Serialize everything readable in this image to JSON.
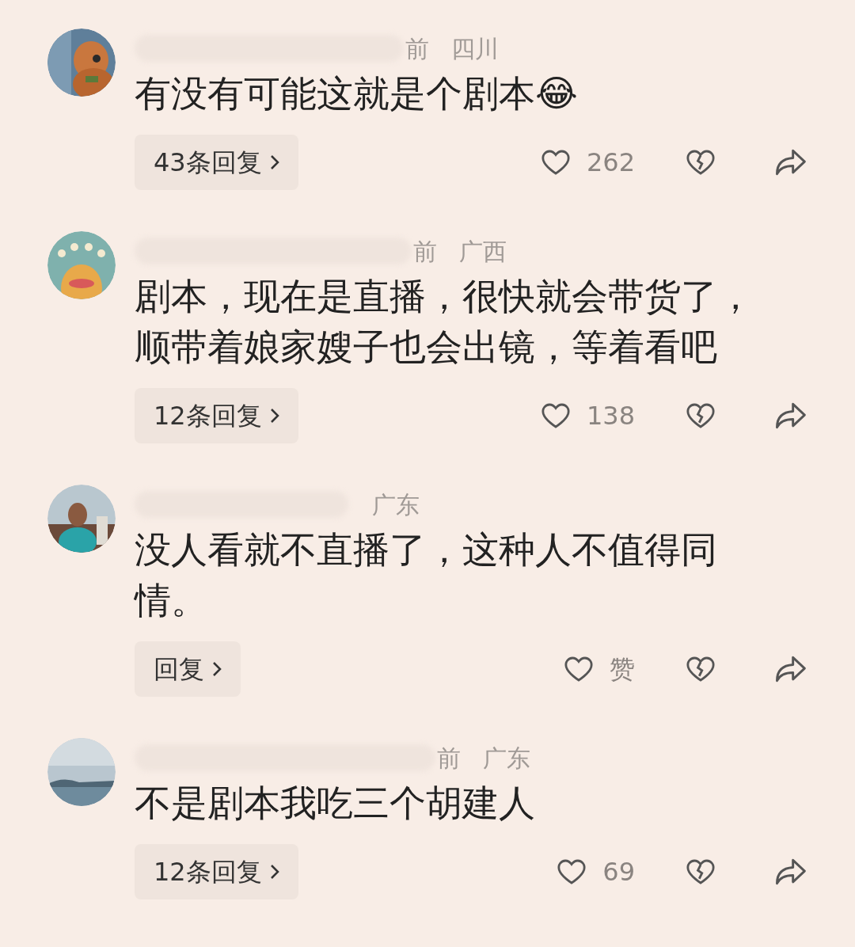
{
  "comments": [
    {
      "avatar": {
        "kind": "cartoon"
      },
      "time": "前",
      "location": "四川",
      "text": "有没有可能这就是个剧本😂",
      "replies": "43条回复",
      "likes": "262"
    },
    {
      "avatar": {
        "kind": "monster"
      },
      "time": "前",
      "location": "广西",
      "text": "剧本，现在是直播，很快就会带货了，顺带着娘家嫂子也会出镜，等着看吧",
      "replies": "12条回复",
      "likes": "138"
    },
    {
      "avatar": {
        "kind": "person"
      },
      "location": "广东",
      "text": "没人看就不直播了，这种人不值得同情。",
      "replies": "回复",
      "likes": "赞"
    },
    {
      "avatar": {
        "kind": "landscape"
      },
      "time": "前",
      "location": "广东",
      "text": "不是剧本我吃三个胡建人",
      "replies": "12条回复",
      "likes": "69"
    }
  ]
}
